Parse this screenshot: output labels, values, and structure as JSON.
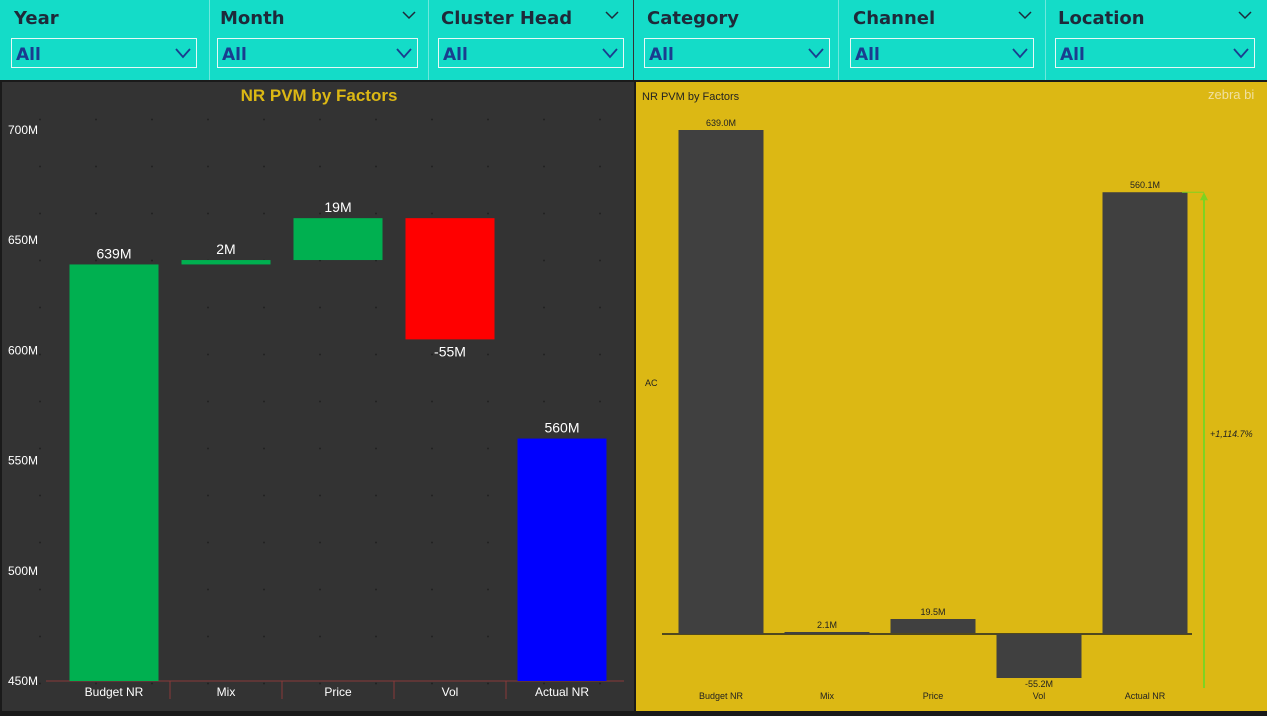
{
  "filters": [
    {
      "label": "Year",
      "value": "All",
      "icon": "chevron-down-icon"
    },
    {
      "label": "Month",
      "value": "All",
      "icon": "chevron-down-icon"
    },
    {
      "label": "Cluster Head",
      "value": "All",
      "icon": "chevron-down-icon"
    },
    {
      "label": "Category",
      "value": "All",
      "icon": "chevron-down-icon"
    },
    {
      "label": "Channel",
      "value": "All",
      "icon": "chevron-down-icon"
    },
    {
      "label": "Location",
      "value": "All",
      "icon": "chevron-down-icon"
    }
  ],
  "colors": {
    "filter_bar": "#14dcc8",
    "left_bg": "#333333",
    "right_bg": "#dcb814",
    "title_gold": "#dcb814",
    "increase": "#00b050",
    "decrease": "#ff0000",
    "total": "#0000ff",
    "zebra_bar": "#404040",
    "variance_arrow": "#7ed321"
  },
  "chart_data": [
    {
      "type": "bar",
      "subtype": "waterfall",
      "title": "NR PVM by Factors",
      "categories": [
        "Budget NR",
        "Mix",
        "Price",
        "Vol",
        "Actual NR"
      ],
      "values": [
        639,
        2,
        19,
        -55,
        560
      ],
      "data_labels": [
        "639M",
        "2M",
        "19M",
        "-55M",
        "560M"
      ],
      "ylim": [
        450,
        700
      ],
      "yticks": [
        "450M",
        "500M",
        "550M",
        "600M",
        "650M",
        "700M"
      ],
      "grid": false
    },
    {
      "type": "bar",
      "subtype": "waterfall",
      "title": "NR PVM by Factors",
      "brand": "zebra bi",
      "categories": [
        "Budget NR",
        "Mix",
        "Price",
        "Vol",
        "Actual NR"
      ],
      "values": [
        639.0,
        2.1,
        19.5,
        -55.2,
        560.1
      ],
      "data_labels": [
        "639.0M",
        "2.1M",
        "19.5M",
        "-55.2M",
        "560.1M"
      ],
      "side_label": "AC",
      "variance_label": "+1,114.7%"
    }
  ]
}
